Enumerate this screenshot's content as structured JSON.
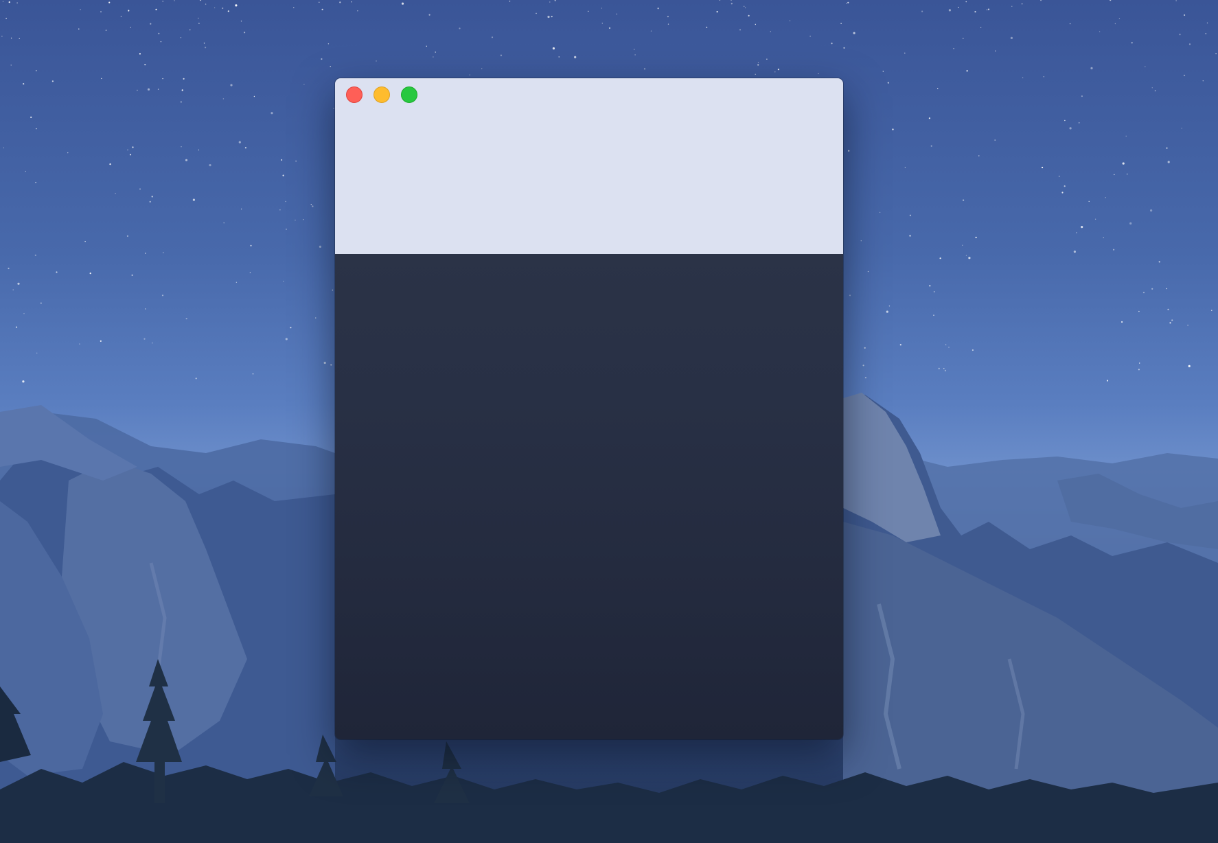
{
  "desktop": {
    "wallpaper": "mountain-night-wallpaper"
  },
  "window": {
    "titlebar_color": "#dce1f1",
    "content_color": "#272e42",
    "controls": [
      {
        "name": "close",
        "color": "#fe5f57"
      },
      {
        "name": "minimize",
        "color": "#febc2e"
      },
      {
        "name": "zoom",
        "color": "#28c840"
      }
    ]
  }
}
